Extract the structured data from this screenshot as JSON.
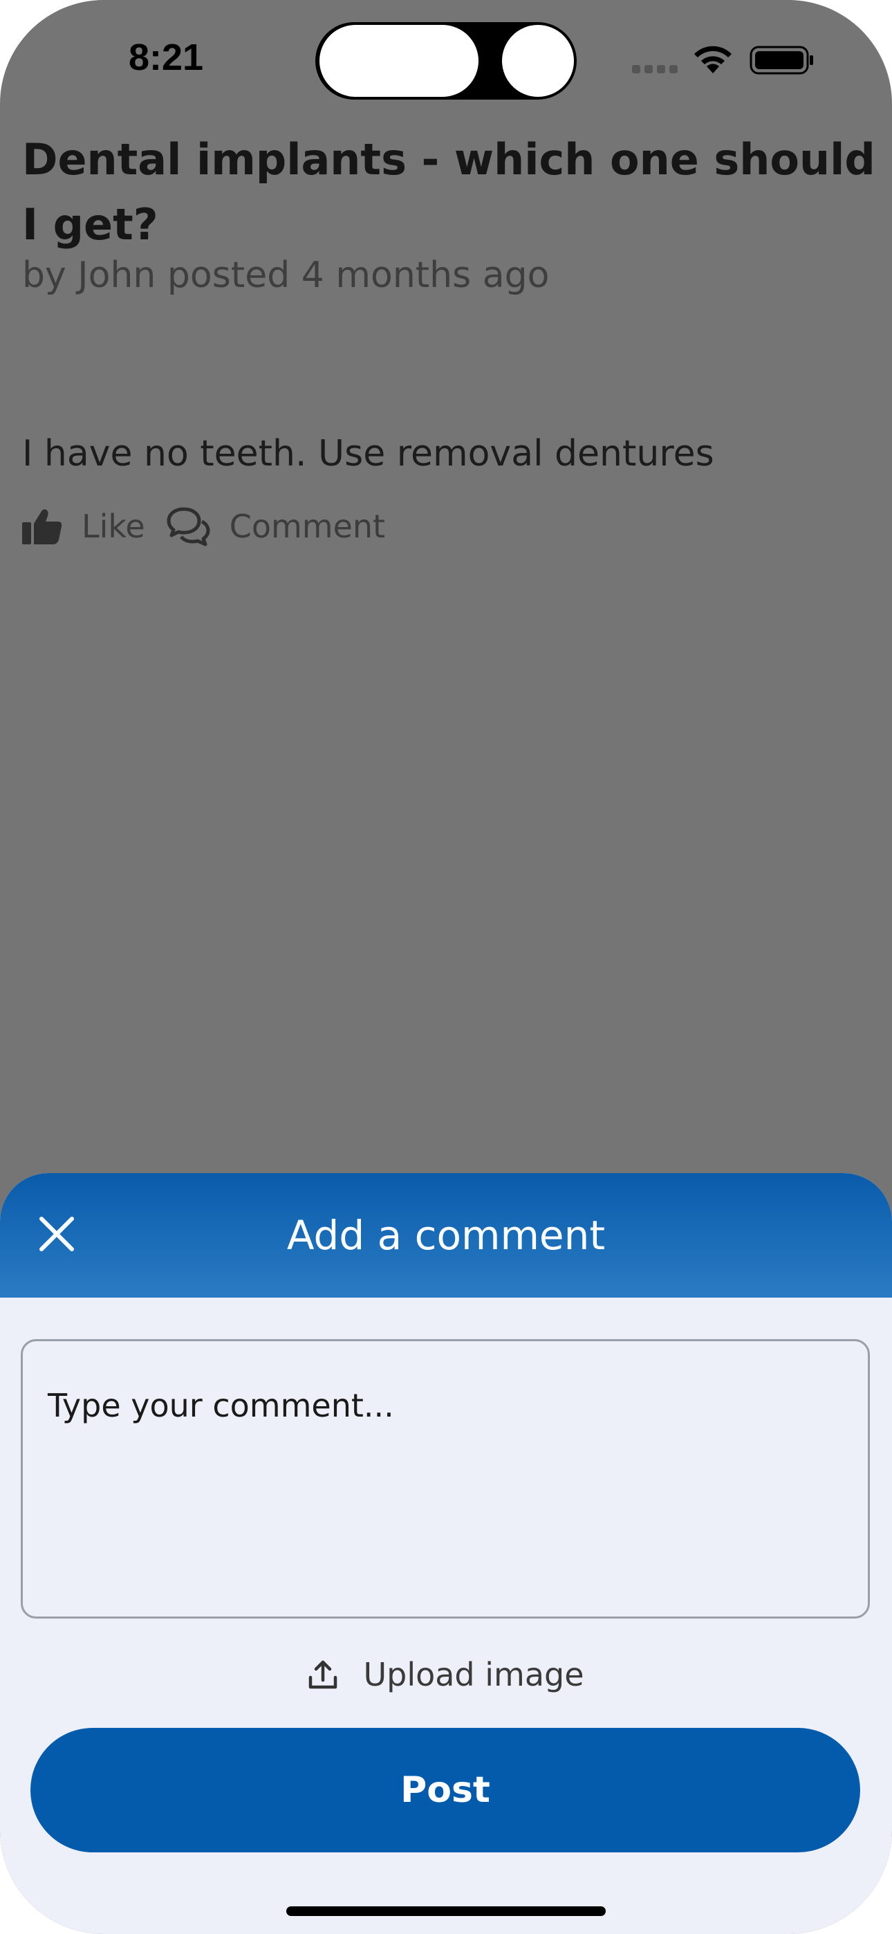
{
  "status_bar": {
    "time": "8:21"
  },
  "post": {
    "title": "Dental implants - which one should I get?",
    "meta": "by John posted 4 months ago",
    "body": "I have no teeth. Use removal dentures",
    "actions": {
      "like_label": "Like",
      "comment_label": "Comment"
    }
  },
  "sheet": {
    "title": "Add a comment",
    "comment_placeholder": "Type your comment...",
    "upload_label": "Upload image",
    "post_label": "Post"
  },
  "colors": {
    "overlay": "#757575",
    "accent": "#055bab",
    "sheet_bg": "#edf0f8",
    "header_top": "#0a5cab",
    "header_bottom": "#2a7bc3"
  },
  "icons": [
    "wifi-icon",
    "battery-icon",
    "thumbs-up-icon",
    "comments-icon",
    "close-icon",
    "upload-icon"
  ]
}
